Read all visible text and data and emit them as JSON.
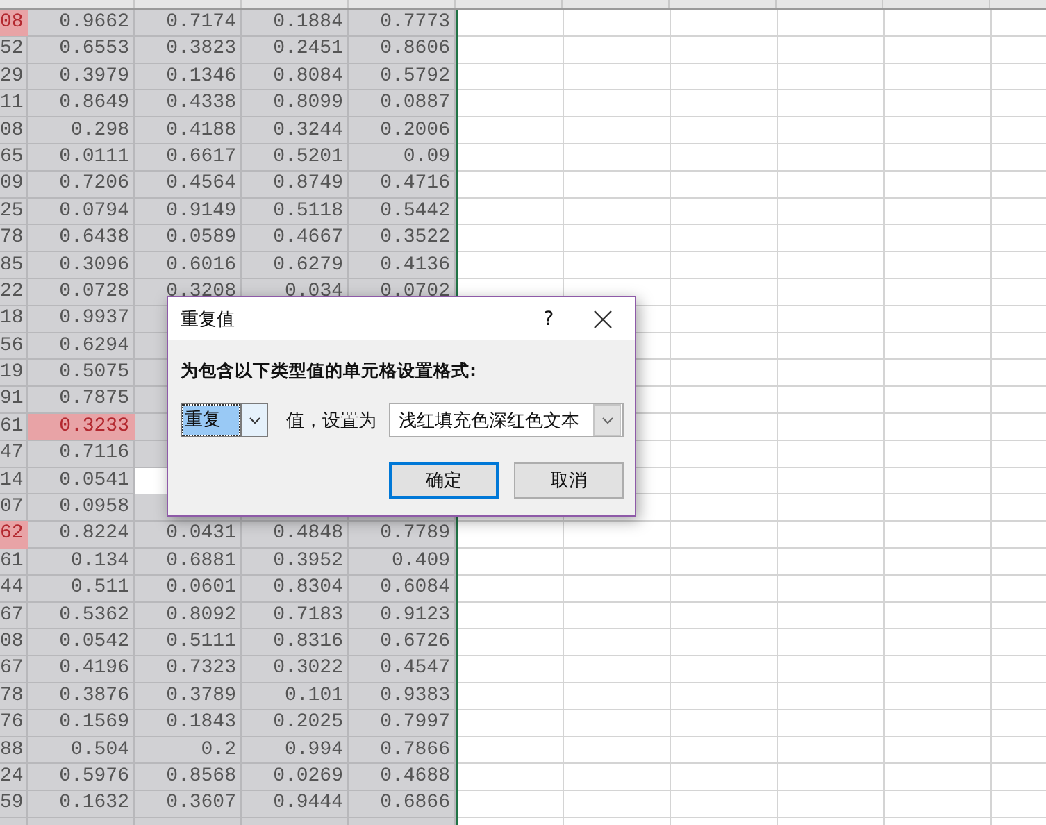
{
  "sheet": {
    "rows": [
      {
        "cells": [
          "08",
          "0.9662",
          "0.7174",
          "0.1884",
          "0.7773"
        ],
        "duplicate": [
          true,
          false,
          false,
          false,
          false
        ],
        "active": [
          false,
          false,
          false,
          false,
          false
        ]
      },
      {
        "cells": [
          "52",
          "0.6553",
          "0.3823",
          "0.2451",
          "0.8606"
        ],
        "duplicate": [
          false,
          false,
          false,
          false,
          false
        ],
        "active": [
          false,
          false,
          false,
          false,
          false
        ]
      },
      {
        "cells": [
          "29",
          "0.3979",
          "0.1346",
          "0.8084",
          "0.5792"
        ],
        "duplicate": [
          false,
          false,
          false,
          false,
          false
        ],
        "active": [
          false,
          false,
          false,
          false,
          false
        ]
      },
      {
        "cells": [
          "11",
          "0.8649",
          "0.4338",
          "0.8099",
          "0.0887"
        ],
        "duplicate": [
          false,
          false,
          false,
          false,
          false
        ],
        "active": [
          false,
          false,
          false,
          false,
          false
        ]
      },
      {
        "cells": [
          "08",
          "0.298",
          "0.4188",
          "0.3244",
          "0.2006"
        ],
        "duplicate": [
          false,
          false,
          false,
          false,
          false
        ],
        "active": [
          false,
          false,
          false,
          false,
          false
        ]
      },
      {
        "cells": [
          "65",
          "0.0111",
          "0.6617",
          "0.5201",
          "0.09"
        ],
        "duplicate": [
          false,
          false,
          false,
          false,
          false
        ],
        "active": [
          false,
          false,
          false,
          false,
          false
        ]
      },
      {
        "cells": [
          "09",
          "0.7206",
          "0.4564",
          "0.8749",
          "0.4716"
        ],
        "duplicate": [
          false,
          false,
          false,
          false,
          false
        ],
        "active": [
          false,
          false,
          false,
          false,
          false
        ]
      },
      {
        "cells": [
          "25",
          "0.0794",
          "0.9149",
          "0.5118",
          "0.5442"
        ],
        "duplicate": [
          false,
          false,
          false,
          false,
          false
        ],
        "active": [
          false,
          false,
          false,
          false,
          false
        ]
      },
      {
        "cells": [
          "78",
          "0.6438",
          "0.0589",
          "0.4667",
          "0.3522"
        ],
        "duplicate": [
          false,
          false,
          false,
          false,
          false
        ],
        "active": [
          false,
          false,
          false,
          false,
          false
        ]
      },
      {
        "cells": [
          "85",
          "0.3096",
          "0.6016",
          "0.6279",
          "0.4136"
        ],
        "duplicate": [
          false,
          false,
          false,
          false,
          false
        ],
        "active": [
          false,
          false,
          false,
          false,
          false
        ]
      },
      {
        "cells": [
          "22",
          "0.0728",
          "0.3208",
          "0.034",
          "0.0702"
        ],
        "duplicate": [
          false,
          false,
          false,
          false,
          false
        ],
        "active": [
          false,
          false,
          false,
          false,
          false
        ]
      },
      {
        "cells": [
          "18",
          "0.9937"
        ],
        "duplicate": [
          false,
          false
        ],
        "active": [
          false,
          false
        ]
      },
      {
        "cells": [
          "56",
          "0.6294"
        ],
        "duplicate": [
          false,
          false
        ],
        "active": [
          false,
          false
        ]
      },
      {
        "cells": [
          "19",
          "0.5075"
        ],
        "duplicate": [
          false,
          false
        ],
        "active": [
          false,
          false
        ]
      },
      {
        "cells": [
          "91",
          "0.7875"
        ],
        "duplicate": [
          false,
          false
        ],
        "active": [
          false,
          false
        ]
      },
      {
        "cells": [
          "61",
          "0.3233"
        ],
        "duplicate": [
          false,
          true
        ],
        "active": [
          false,
          false
        ]
      },
      {
        "cells": [
          "47",
          "0.7116"
        ],
        "duplicate": [
          false,
          false
        ],
        "active": [
          false,
          false
        ]
      },
      {
        "cells": [
          "14",
          "0.0541"
        ],
        "duplicate": [
          false,
          false
        ],
        "active": [
          false,
          false,
          true
        ]
      },
      {
        "cells": [
          "07",
          "0.0958"
        ],
        "duplicate": [
          false,
          false
        ],
        "active": [
          false,
          false
        ]
      },
      {
        "cells": [
          "62",
          "0.8224",
          "0.0431",
          "0.4848",
          "0.7789"
        ],
        "duplicate": [
          true,
          false,
          false,
          false,
          false
        ],
        "active": [
          false,
          false,
          false,
          false,
          false
        ]
      },
      {
        "cells": [
          "61",
          "0.134",
          "0.6881",
          "0.3952",
          "0.409"
        ],
        "duplicate": [
          false,
          false,
          false,
          false,
          false
        ],
        "active": [
          false,
          false,
          false,
          false,
          false
        ]
      },
      {
        "cells": [
          "44",
          "0.511",
          "0.0601",
          "0.8304",
          "0.6084"
        ],
        "duplicate": [
          false,
          false,
          false,
          false,
          false
        ],
        "active": [
          false,
          false,
          false,
          false,
          false
        ]
      },
      {
        "cells": [
          "67",
          "0.5362",
          "0.8092",
          "0.7183",
          "0.9123"
        ],
        "duplicate": [
          false,
          false,
          false,
          false,
          false
        ],
        "active": [
          false,
          false,
          false,
          false,
          false
        ]
      },
      {
        "cells": [
          "08",
          "0.0542",
          "0.5111",
          "0.8316",
          "0.6726"
        ],
        "duplicate": [
          false,
          false,
          false,
          false,
          false
        ],
        "active": [
          false,
          false,
          false,
          false,
          false
        ]
      },
      {
        "cells": [
          "67",
          "0.4196",
          "0.7323",
          "0.3022",
          "0.4547"
        ],
        "duplicate": [
          false,
          false,
          false,
          false,
          false
        ],
        "active": [
          false,
          false,
          false,
          false,
          false
        ]
      },
      {
        "cells": [
          "78",
          "0.3876",
          "0.3789",
          "0.101",
          "0.9383"
        ],
        "duplicate": [
          false,
          false,
          false,
          false,
          false
        ],
        "active": [
          false,
          false,
          false,
          false,
          false
        ]
      },
      {
        "cells": [
          "76",
          "0.1569",
          "0.1843",
          "0.2025",
          "0.7997"
        ],
        "duplicate": [
          false,
          false,
          false,
          false,
          false
        ],
        "active": [
          false,
          false,
          false,
          false,
          false
        ]
      },
      {
        "cells": [
          "88",
          "0.504",
          "0.2",
          "0.994",
          "0.7866"
        ],
        "duplicate": [
          false,
          false,
          false,
          false,
          false
        ],
        "active": [
          false,
          false,
          false,
          false,
          false
        ]
      },
      {
        "cells": [
          "24",
          "0.5976",
          "0.8568",
          "0.0269",
          "0.4688"
        ],
        "duplicate": [
          false,
          false,
          false,
          false,
          false
        ],
        "active": [
          false,
          false,
          false,
          false,
          false
        ]
      },
      {
        "cells": [
          "59",
          "0.1632",
          "0.3607",
          "0.9444",
          "0.6866"
        ],
        "duplicate": [
          false,
          false,
          false,
          false,
          false
        ],
        "active": [
          false,
          false,
          false,
          false,
          false
        ]
      }
    ]
  },
  "dialog": {
    "title": "重复值",
    "help": "?",
    "prompt": "为包含以下类型值的单元格设置格式:",
    "type_combo": {
      "value": "重复"
    },
    "value_label": "值，设置为",
    "format_select": {
      "value": "浅红填充色深红色文本"
    },
    "buttons": [
      {
        "label": "确定",
        "default": true
      },
      {
        "label": "取消",
        "default": false
      }
    ]
  }
}
